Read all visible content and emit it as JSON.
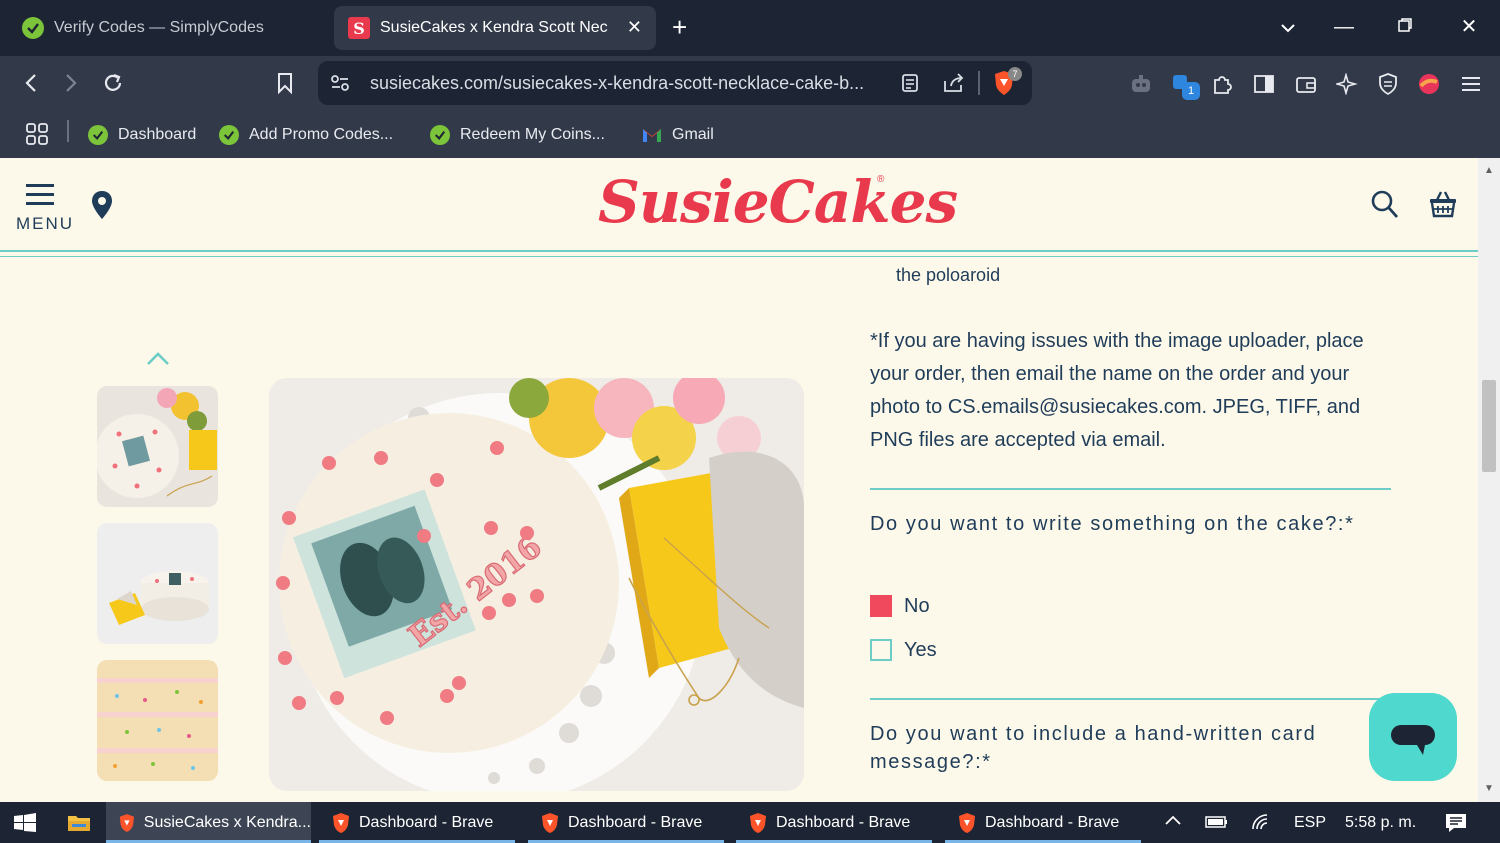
{
  "browser": {
    "tabs": [
      {
        "title": "Verify Codes — SimplyCodes",
        "active": false
      },
      {
        "title": "SusieCakes x Kendra Scott Neck",
        "active": true
      }
    ],
    "new_tab_label": "+",
    "url": "susiecakes.com/susiecakes-x-kendra-scott-necklace-cake-b...",
    "shield_count": "7",
    "extension_badge": "1",
    "bookmarks": [
      {
        "label": "Dashboard",
        "icon": "simplycodes-icon"
      },
      {
        "label": "Add Promo Codes...",
        "icon": "simplycodes-icon"
      },
      {
        "label": "Redeem My Coins...",
        "icon": "simplycodes-icon"
      },
      {
        "label": "Gmail",
        "icon": "gmail-icon"
      }
    ]
  },
  "site": {
    "menu_label": "MENU",
    "logo_text": "SusieCakes",
    "logo_reg": "®",
    "brand_color": "#e83a4c",
    "accent_color": "#6dcdc6",
    "text_color": "#1f3c59"
  },
  "product": {
    "thumbnails": [
      {
        "alt": "Cake with necklace and flowers"
      },
      {
        "alt": "Cake with gift box"
      },
      {
        "alt": "Funfetti cake slice"
      }
    ],
    "cake_inscription": "Est. 2016"
  },
  "form": {
    "poloroid_line": "the poloaroid",
    "upload_note": "*If you are having issues with the image uploader, place your order, then email the name on the order and your photo to CS.emails@susiecakes.com. JPEG, TIFF, and PNG files are accepted via email.",
    "question_write": "Do you want to write something on the cake?:*",
    "options_write": [
      {
        "label": "No",
        "checked": true
      },
      {
        "label": "Yes",
        "checked": false
      }
    ],
    "question_card": "Do you want to include a hand-written card message?:*"
  },
  "taskbar": {
    "items": [
      {
        "label": "SusieCakes x Kendra...",
        "active": true
      },
      {
        "label": "Dashboard - Brave",
        "active": false
      },
      {
        "label": "Dashboard - Brave",
        "active": false
      },
      {
        "label": "Dashboard - Brave",
        "active": false
      },
      {
        "label": "Dashboard - Brave",
        "active": false
      }
    ],
    "language": "ESP",
    "time": "5:58 p. m."
  }
}
